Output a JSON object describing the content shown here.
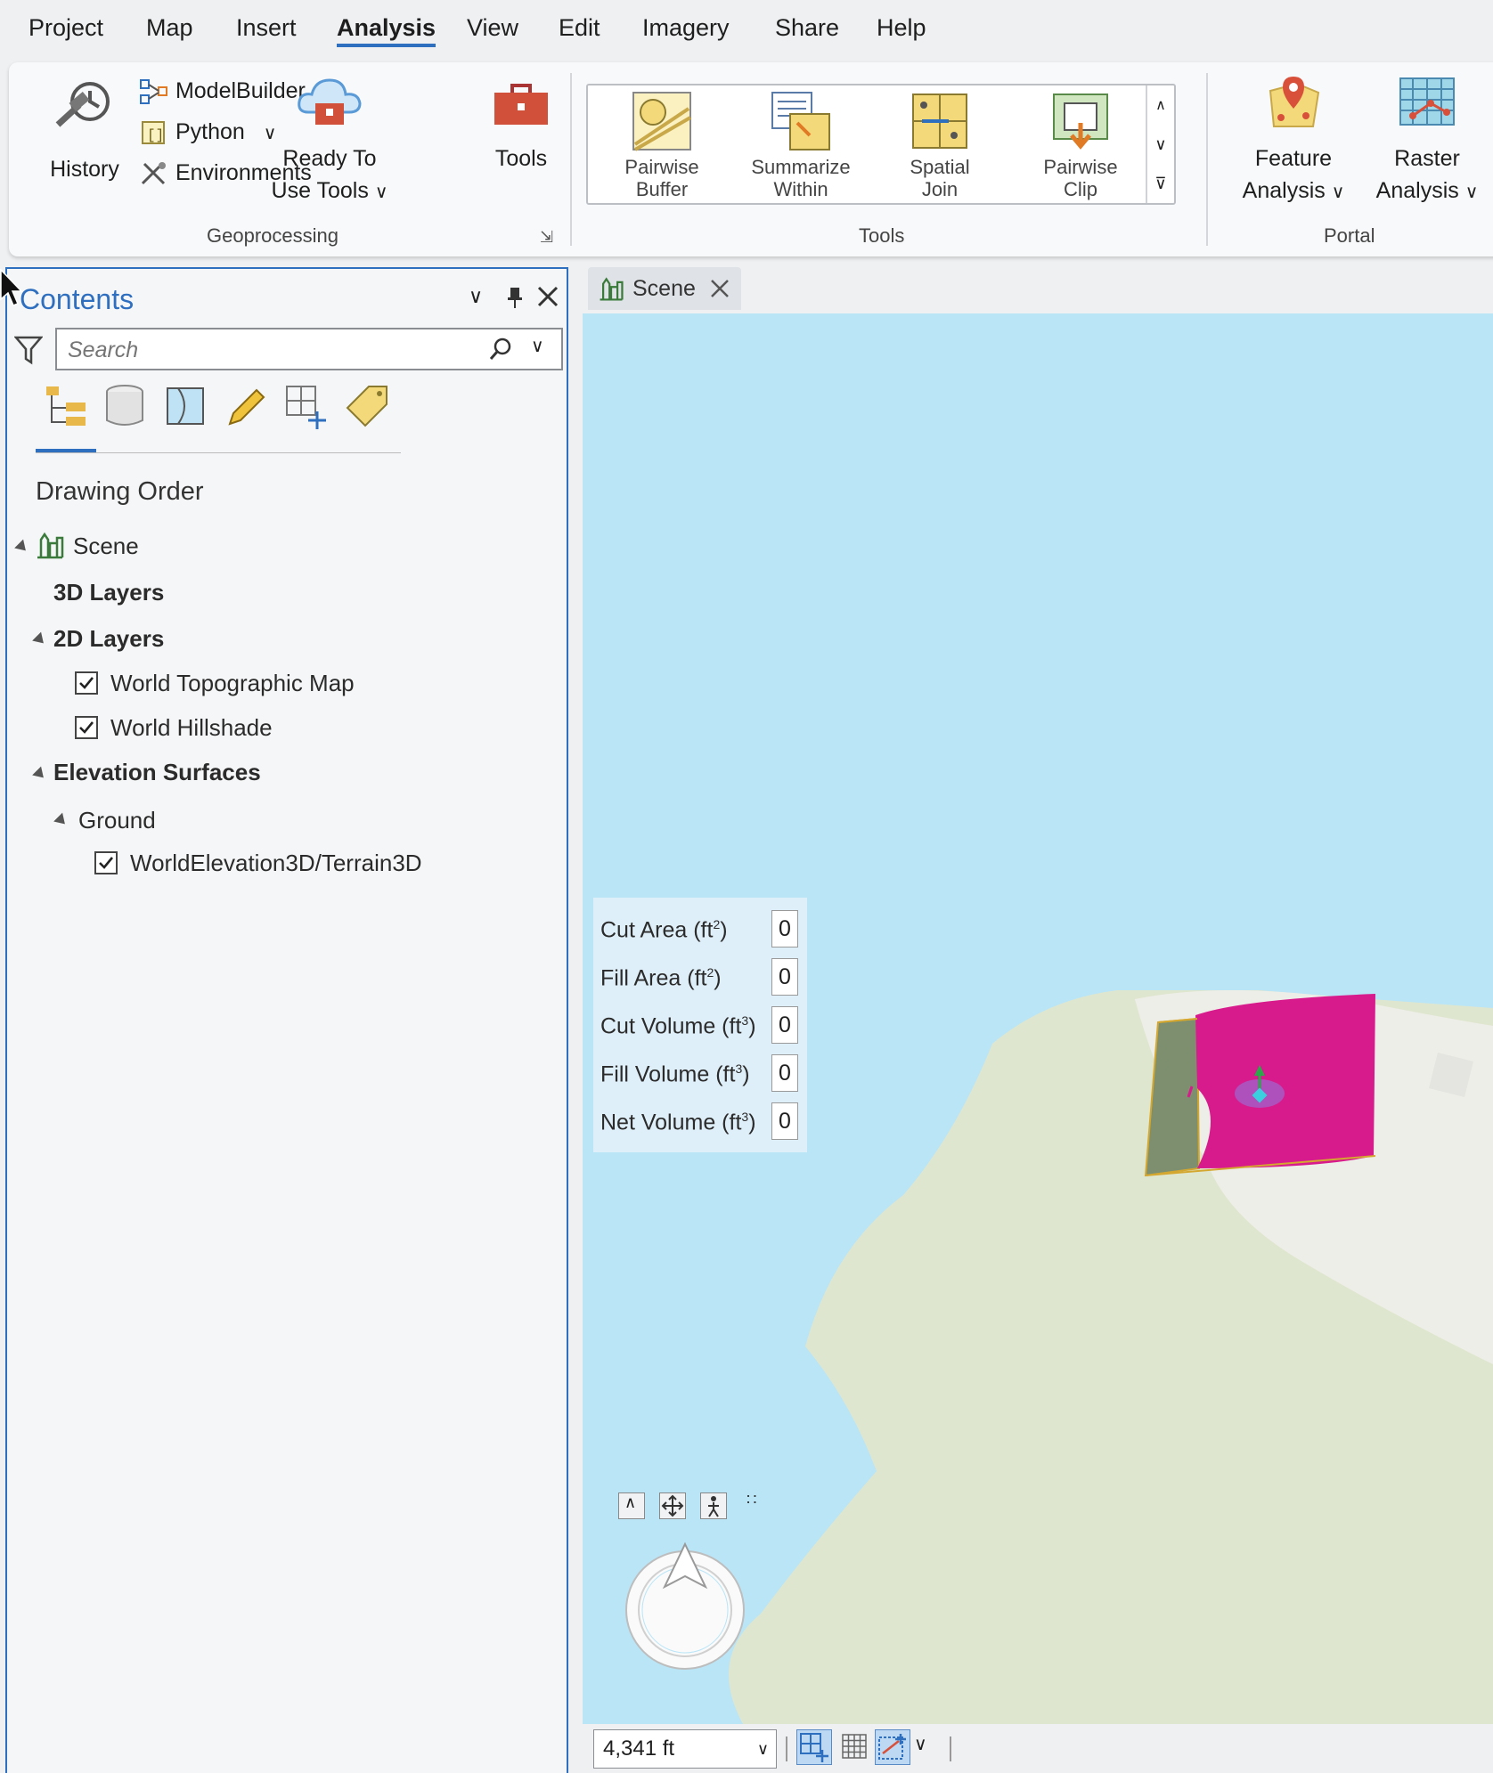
{
  "menu": {
    "items": [
      "Project",
      "Map",
      "Insert",
      "Analysis",
      "View",
      "Edit",
      "Imagery",
      "Share",
      "Help"
    ],
    "active": "Analysis"
  },
  "ribbon": {
    "history": "History",
    "modelbuilder": "ModelBuilder",
    "python": "Python",
    "environments": "Environments",
    "ready_to_use_line1": "Ready To",
    "ready_to_use_line2": "Use Tools",
    "tools": "Tools",
    "group_geoprocessing": "Geoprocessing",
    "gallery": [
      {
        "line1": "Pairwise",
        "line2": "Buffer"
      },
      {
        "line1": "Summarize",
        "line2": "Within"
      },
      {
        "line1": "Spatial",
        "line2": "Join"
      },
      {
        "line1": "Pairwise",
        "line2": "Clip"
      }
    ],
    "group_tools": "Tools",
    "feature_line1": "Feature",
    "feature_line2": "Analysis",
    "raster_line1": "Raster",
    "raster_line2": "Analysis",
    "group_portal": "Portal"
  },
  "contents": {
    "title": "Contents",
    "search_placeholder": "Search",
    "section": "Drawing Order",
    "scene": "Scene",
    "layers3d": "3D Layers",
    "layers2d": "2D Layers",
    "topo": "World Topographic Map",
    "hillshade": "World Hillshade",
    "elevation": "Elevation Surfaces",
    "ground": "Ground",
    "terrain": "WorldElevation3D/Terrain3D"
  },
  "scene": {
    "tab": "Scene",
    "stats": [
      {
        "label": "Cut Area (ft",
        "sup": "2",
        "value": "0"
      },
      {
        "label": "Fill Area (ft",
        "sup": "2",
        "value": "0"
      },
      {
        "label": "Cut Volume (ft",
        "sup": "3",
        "value": "0"
      },
      {
        "label": "Fill Volume (ft",
        "sup": "3",
        "value": "0"
      },
      {
        "label": "Net Volume (ft",
        "sup": "3",
        "value": "0"
      }
    ],
    "scale": "4,341 ft"
  },
  "colors": {
    "accent": "#2f6fbf",
    "water": "#b9e5f7",
    "land": "#dfe6cf",
    "fill_polygon": "#d81b8c",
    "cut_polygon": "#7d8f6e"
  }
}
